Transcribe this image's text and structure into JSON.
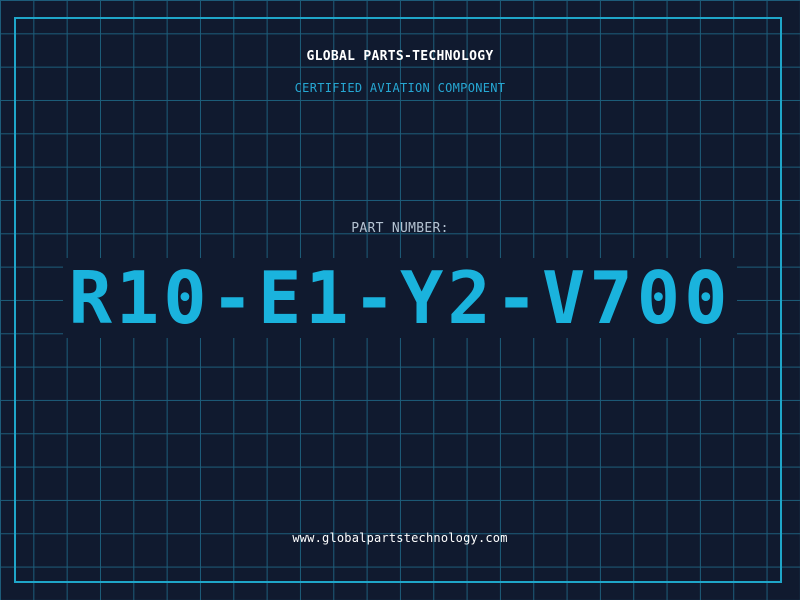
{
  "header": {
    "company": "GLOBAL PARTS-TECHNOLOGY",
    "subtitle": "CERTIFIED AVIATION COMPONENT"
  },
  "part": {
    "label": "PART NUMBER:",
    "number": "R10-E1-Y2-V700"
  },
  "footer": {
    "website": "www.globalpartstechnology.com"
  },
  "colors": {
    "background": "#101a2f",
    "grid": "#1d5d7a",
    "accent": "#1ab3dd",
    "frame": "#1fa6c9"
  }
}
